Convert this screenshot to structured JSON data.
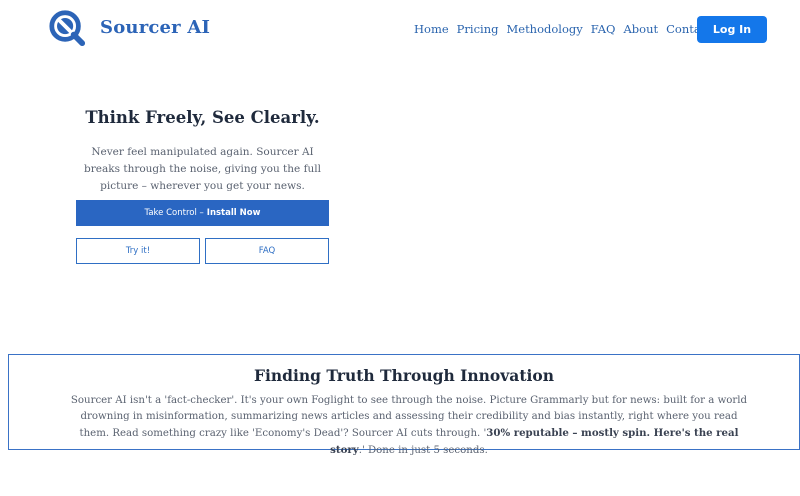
{
  "header": {
    "brand_name": "Sourcer AI",
    "nav": [
      "Home",
      "Pricing",
      "Methodology",
      "FAQ",
      "About",
      "Contact Us"
    ],
    "login_label": "Log In",
    "logo_icon": "magnifier-logo-icon"
  },
  "hero": {
    "title": "Think Freely, See Clearly.",
    "text": "Never feel manipulated again. Sourcer AI breaks through the noise, giving you the full picture – wherever you get your news.",
    "cta_prefix": "Take Control –",
    "cta_bold": "Install Now",
    "try_label": "Try it!",
    "faq_label": "FAQ"
  },
  "innovation": {
    "title": "Finding Truth Through Innovation",
    "text_before": "Sourcer AI isn't a 'fact-checker'. It's your own Foglight to see through the noise. Picture Grammarly but for news: built for a world drowning in misinformation, summarizing news articles and assessing their credibility and bias instantly, right where you read them. Read something crazy like 'Economy's Dead'? Sourcer AI cuts through. '",
    "text_bold": "30% reputable – mostly spin. Here's the real story",
    "text_after": ".' Done in just 5 seconds."
  },
  "colors": {
    "brand": "#2c64b7",
    "login_bg": "#1477ea",
    "cta_bg": "#2a66c2",
    "border": "#3a72c6"
  }
}
